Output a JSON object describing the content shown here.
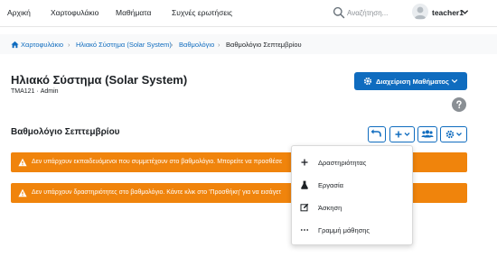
{
  "nav": {
    "items": [
      "Αρχική",
      "Χαρτοφυλάκιο",
      "Μαθήματα",
      "Συχνές ερωτήσεις"
    ],
    "search_placeholder": "Αναζήτηση...",
    "username": "teacher1"
  },
  "breadcrumb": [
    "Χαρτοφυλάκιο",
    "Ηλιακό Σύστημα (Solar System)",
    "Βαθμολόγιο",
    "Βαθμολόγιο Σεπτεμβρίου"
  ],
  "course": {
    "title": "Ηλιακό Σύστημα (Solar System)",
    "code": "ΤΜΑ121",
    "separator": "·",
    "role": "Admin",
    "manage_label": "Διαχείριση Μαθήματος"
  },
  "page": {
    "heading": "Βαθμολόγιο Σεπτεμβρίου"
  },
  "alerts": [
    "Δεν υπάρχουν εκπαιδευόμενοι που συμμετέχουν στο βαθμολόγιο. Μπορείτε να προσθέσε",
    "Δεν υπάρχουν δραστηριότητες στο βαθμολόγιο. Κάντε κλικ στο 'Προσθήκη' για να εισάγετ"
  ],
  "dropdown": {
    "items": [
      {
        "label": "Δραστηριότητας",
        "icon": "plus-icon"
      },
      {
        "label": "Εργασία",
        "icon": "flask-icon"
      },
      {
        "label": "Άσκηση",
        "icon": "edit-icon"
      },
      {
        "label": "Γραμμή μάθησης",
        "icon": "ellipsis-icon"
      }
    ]
  },
  "colors": {
    "primary": "#0f6cbf",
    "warning": "#f0840c",
    "text": "#1d2125"
  }
}
